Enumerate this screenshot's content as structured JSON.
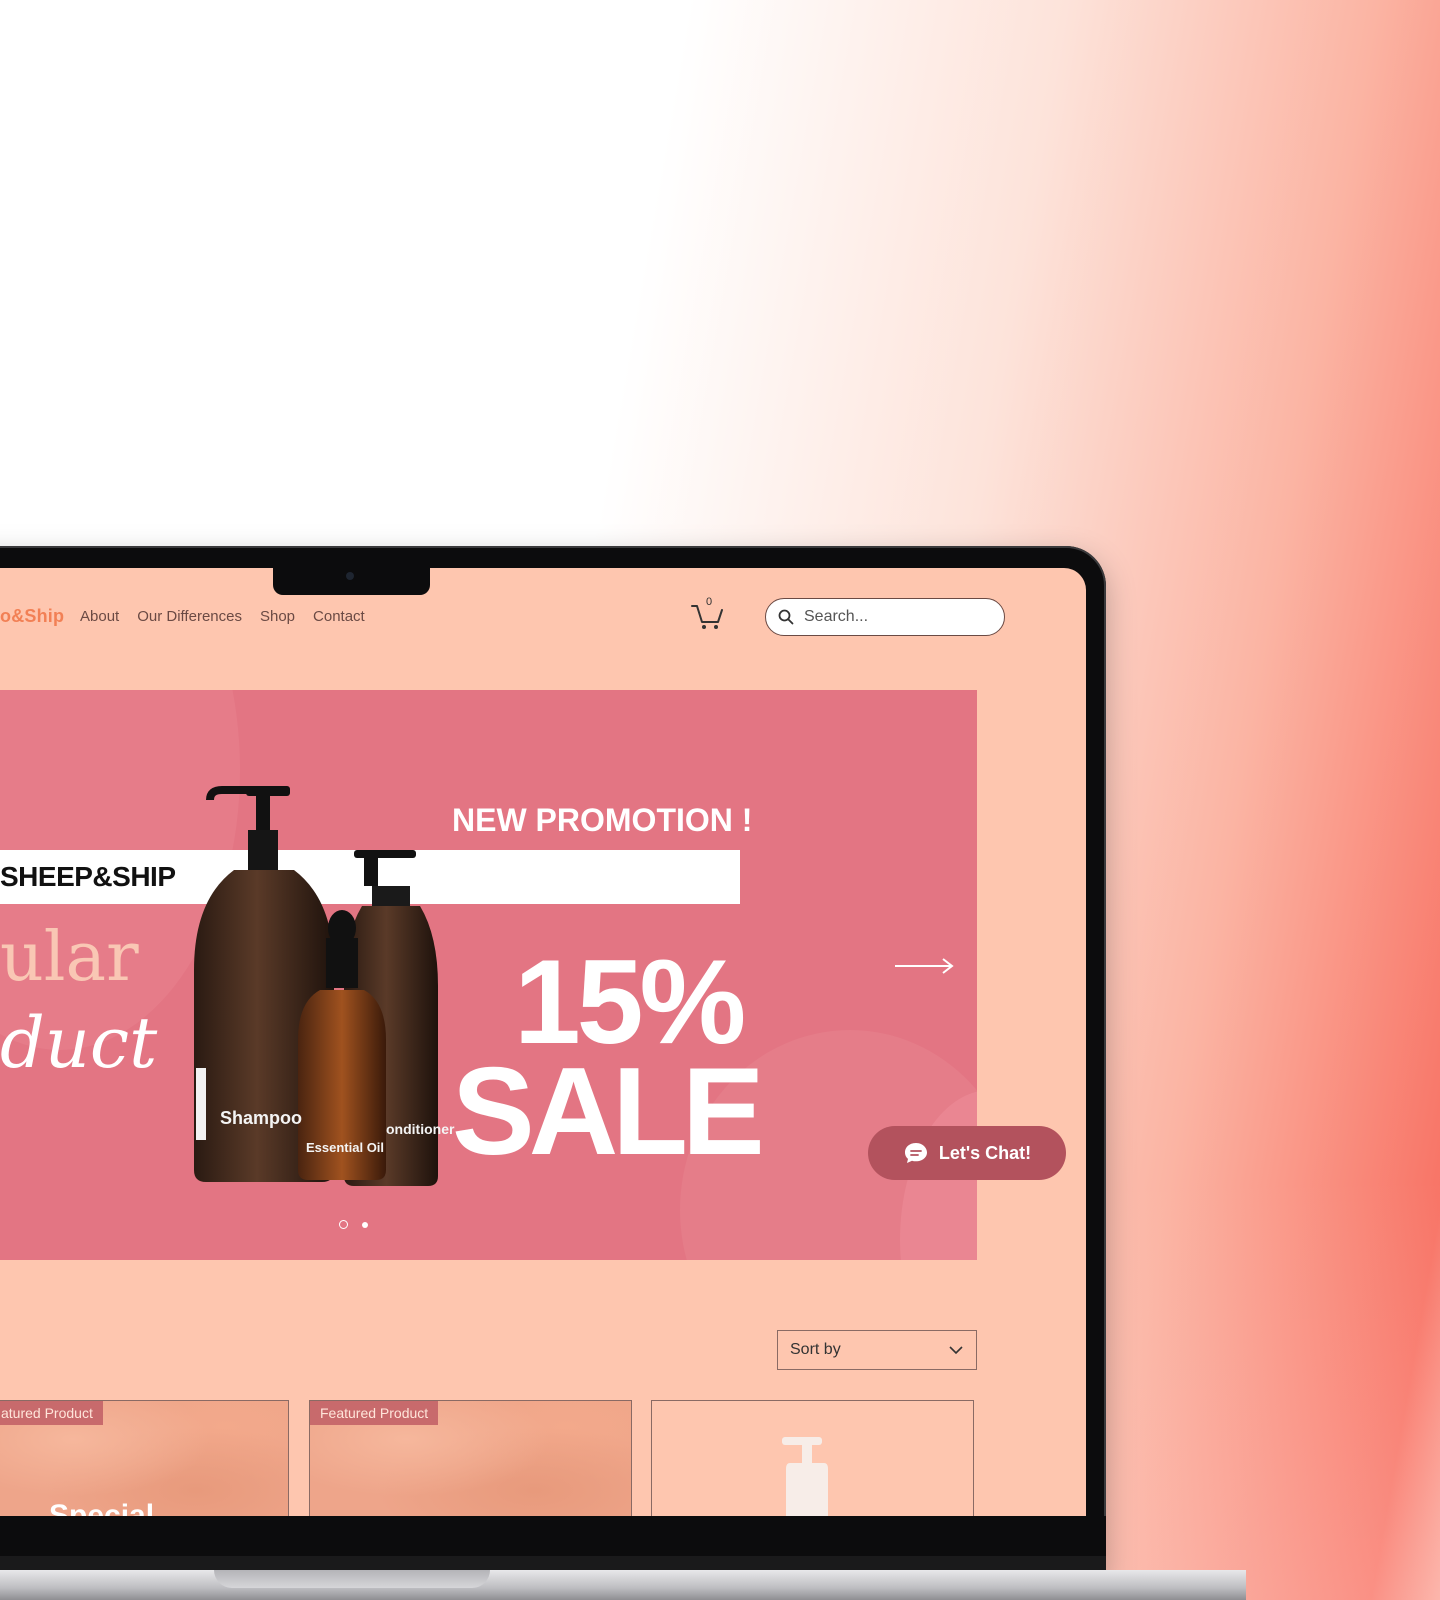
{
  "site": {
    "logo": "o&Ship",
    "nav": [
      "About",
      "Our Differences",
      "Shop",
      "Contact"
    ],
    "cart_count": "0",
    "search_placeholder": "Search..."
  },
  "hero": {
    "brand_band": "SHEEP&SHIP",
    "promotion": "NEW PROMOTION !",
    "tagline_line1": "ular",
    "tagline_line2": "duct",
    "percent": "15%",
    "sale": "SALE",
    "bottle_labels": [
      "Shampoo",
      "Essential Oil",
      "onditioner"
    ],
    "slide_count": 2,
    "active_slide": 2
  },
  "chat": {
    "label": "Let's Chat!"
  },
  "sort": {
    "label": "Sort by"
  },
  "products": [
    {
      "badge": "atured Product",
      "title": "Special"
    },
    {
      "badge": "Featured Product",
      "title": ""
    },
    {
      "badge": "",
      "title": ""
    }
  ],
  "colors": {
    "screen_bg": "#fec6af",
    "hero_bg": "#e37583",
    "logo": "#f28055",
    "chat_bg": "#b3525d",
    "badge_bg": "#c86a6c"
  }
}
